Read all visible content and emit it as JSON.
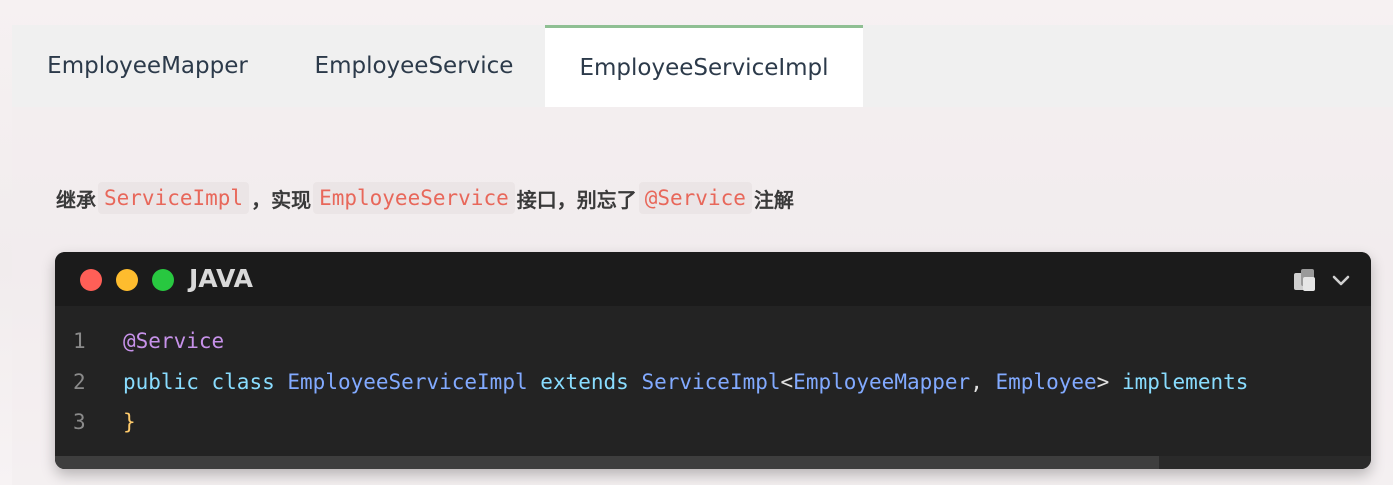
{
  "tabs": [
    {
      "label": "EmployeeMapper",
      "active": false
    },
    {
      "label": "EmployeeService",
      "active": false
    },
    {
      "label": "EmployeeServiceImpl",
      "active": true
    }
  ],
  "colors": {
    "active_tab_border": "#8fbf93",
    "inline_code": "#e8675a",
    "code_bg": "#232323"
  },
  "description": {
    "part1": "继承",
    "code1": "ServiceImpl",
    "part2": "，实现",
    "code2": "EmployeeService",
    "part3": "接口，别忘了",
    "code3": "@Service",
    "part4": "注解"
  },
  "code_block": {
    "language": "JAVA",
    "icons": [
      "copy-icon",
      "chevron-down-icon"
    ],
    "lines": [
      {
        "number": "1",
        "annotation": "@Service"
      },
      {
        "number": "2",
        "kw_public": "public",
        "kw_class": "class",
        "class_name": "EmployeeServiceImpl",
        "kw_extends": "extends",
        "super_type": "ServiceImpl",
        "lt": "<",
        "generic1": "EmployeeMapper",
        "comma": ",",
        "generic2": "Employee",
        "gt": ">",
        "kw_implements": "implements"
      },
      {
        "number": "3",
        "brace": "}"
      }
    ]
  }
}
